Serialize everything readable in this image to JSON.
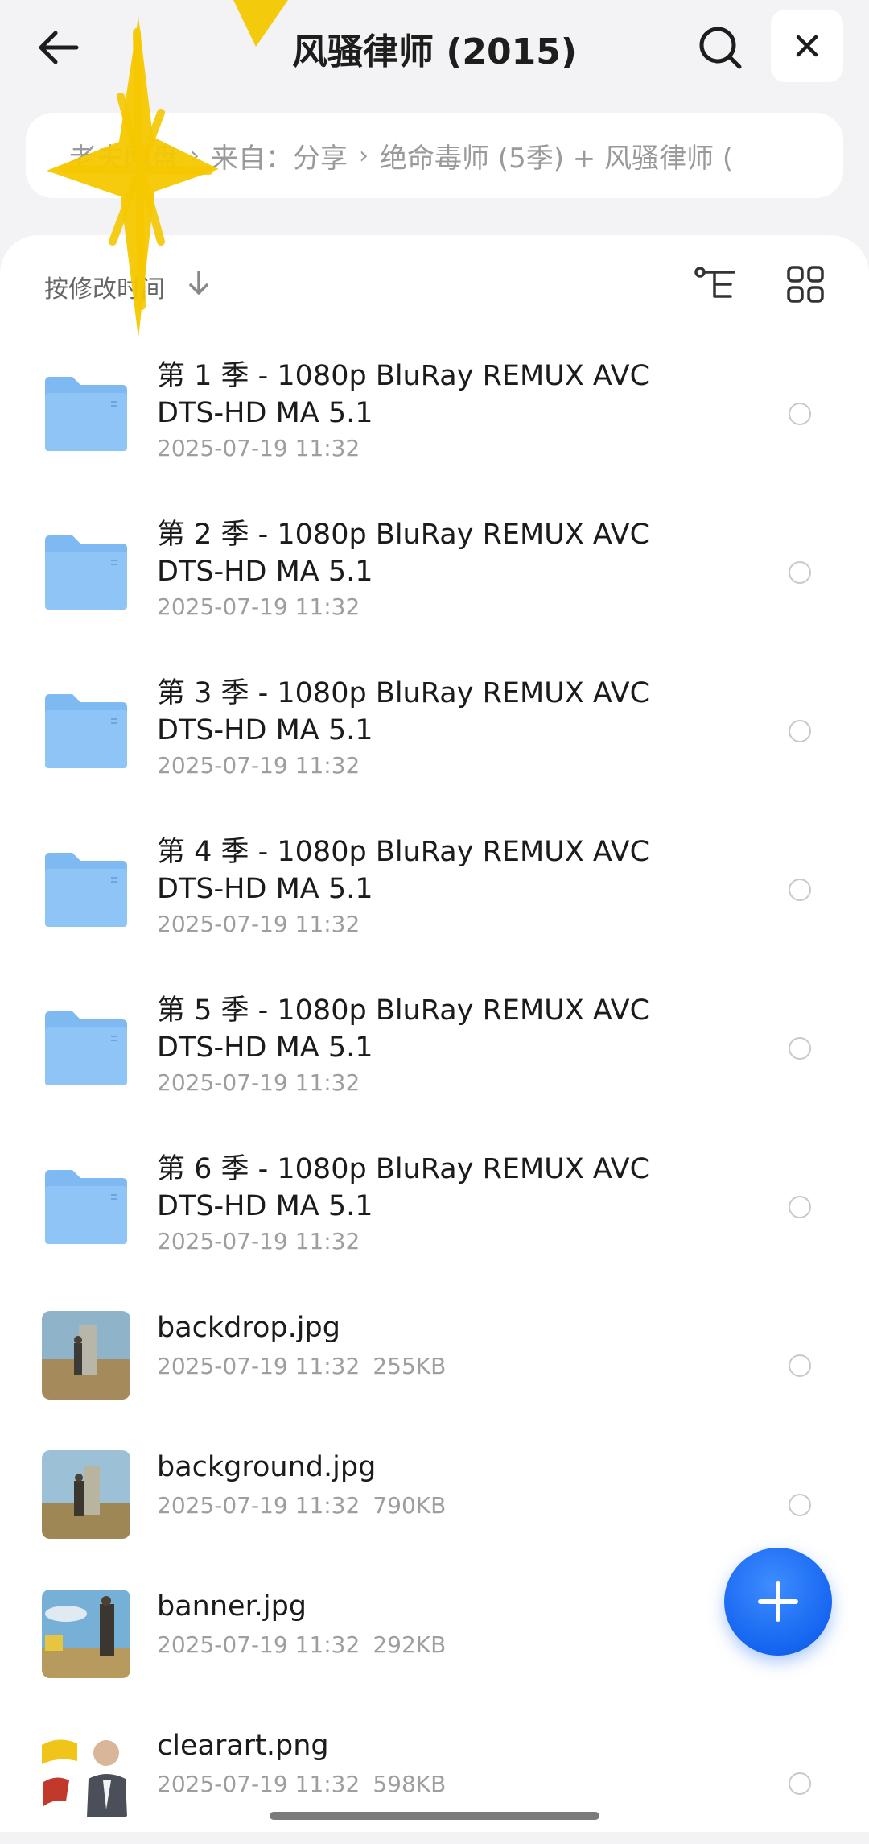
{
  "header": {
    "title": "风骚律师 (2015)"
  },
  "breadcrumb": {
    "items": [
      "老夫网盘",
      "来自：分享",
      "绝命毒师 (5季) + 风骚律师 ("
    ]
  },
  "sort": {
    "label": "按修改时间"
  },
  "files": [
    {
      "name": "第 1 季 - 1080p BluRay REMUX AVC DTS-HD MA 5.1",
      "date": "2025-07-19 11:32"
    },
    {
      "name": "第 2 季 - 1080p BluRay REMUX AVC DTS-HD MA 5.1",
      "date": "2025-07-19 11:32"
    },
    {
      "name": "第 3 季 - 1080p BluRay REMUX AVC DTS-HD MA 5.1",
      "date": "2025-07-19 11:32"
    },
    {
      "name": "第 4 季 - 1080p BluRay REMUX AVC DTS-HD MA 5.1",
      "date": "2025-07-19 11:32"
    },
    {
      "name": "第 5 季 - 1080p BluRay REMUX AVC DTS-HD MA 5.1",
      "date": "2025-07-19 11:32"
    },
    {
      "name": "第 6 季 - 1080p BluRay REMUX AVC DTS-HD MA 5.1",
      "date": "2025-07-19 11:32"
    },
    {
      "name": "backdrop.jpg",
      "date": "2025-07-19 11:32",
      "size": "255KB"
    },
    {
      "name": "background.jpg",
      "date": "2025-07-19 11:32",
      "size": "790KB"
    },
    {
      "name": "banner.jpg",
      "date": "2025-07-19 11:32",
      "size": "292KB"
    },
    {
      "name": "clearart.png",
      "date": "2025-07-19 11:32",
      "size": "598KB"
    }
  ],
  "colors": {
    "accent": "#1565f0",
    "folder": "#8cc3f5",
    "scribble": "#f5c800"
  },
  "icons": [
    "back-arrow-icon",
    "search-icon",
    "close-icon",
    "sort-down-icon",
    "tree-view-icon",
    "grid-view-icon",
    "folder-icon",
    "plus-icon"
  ]
}
